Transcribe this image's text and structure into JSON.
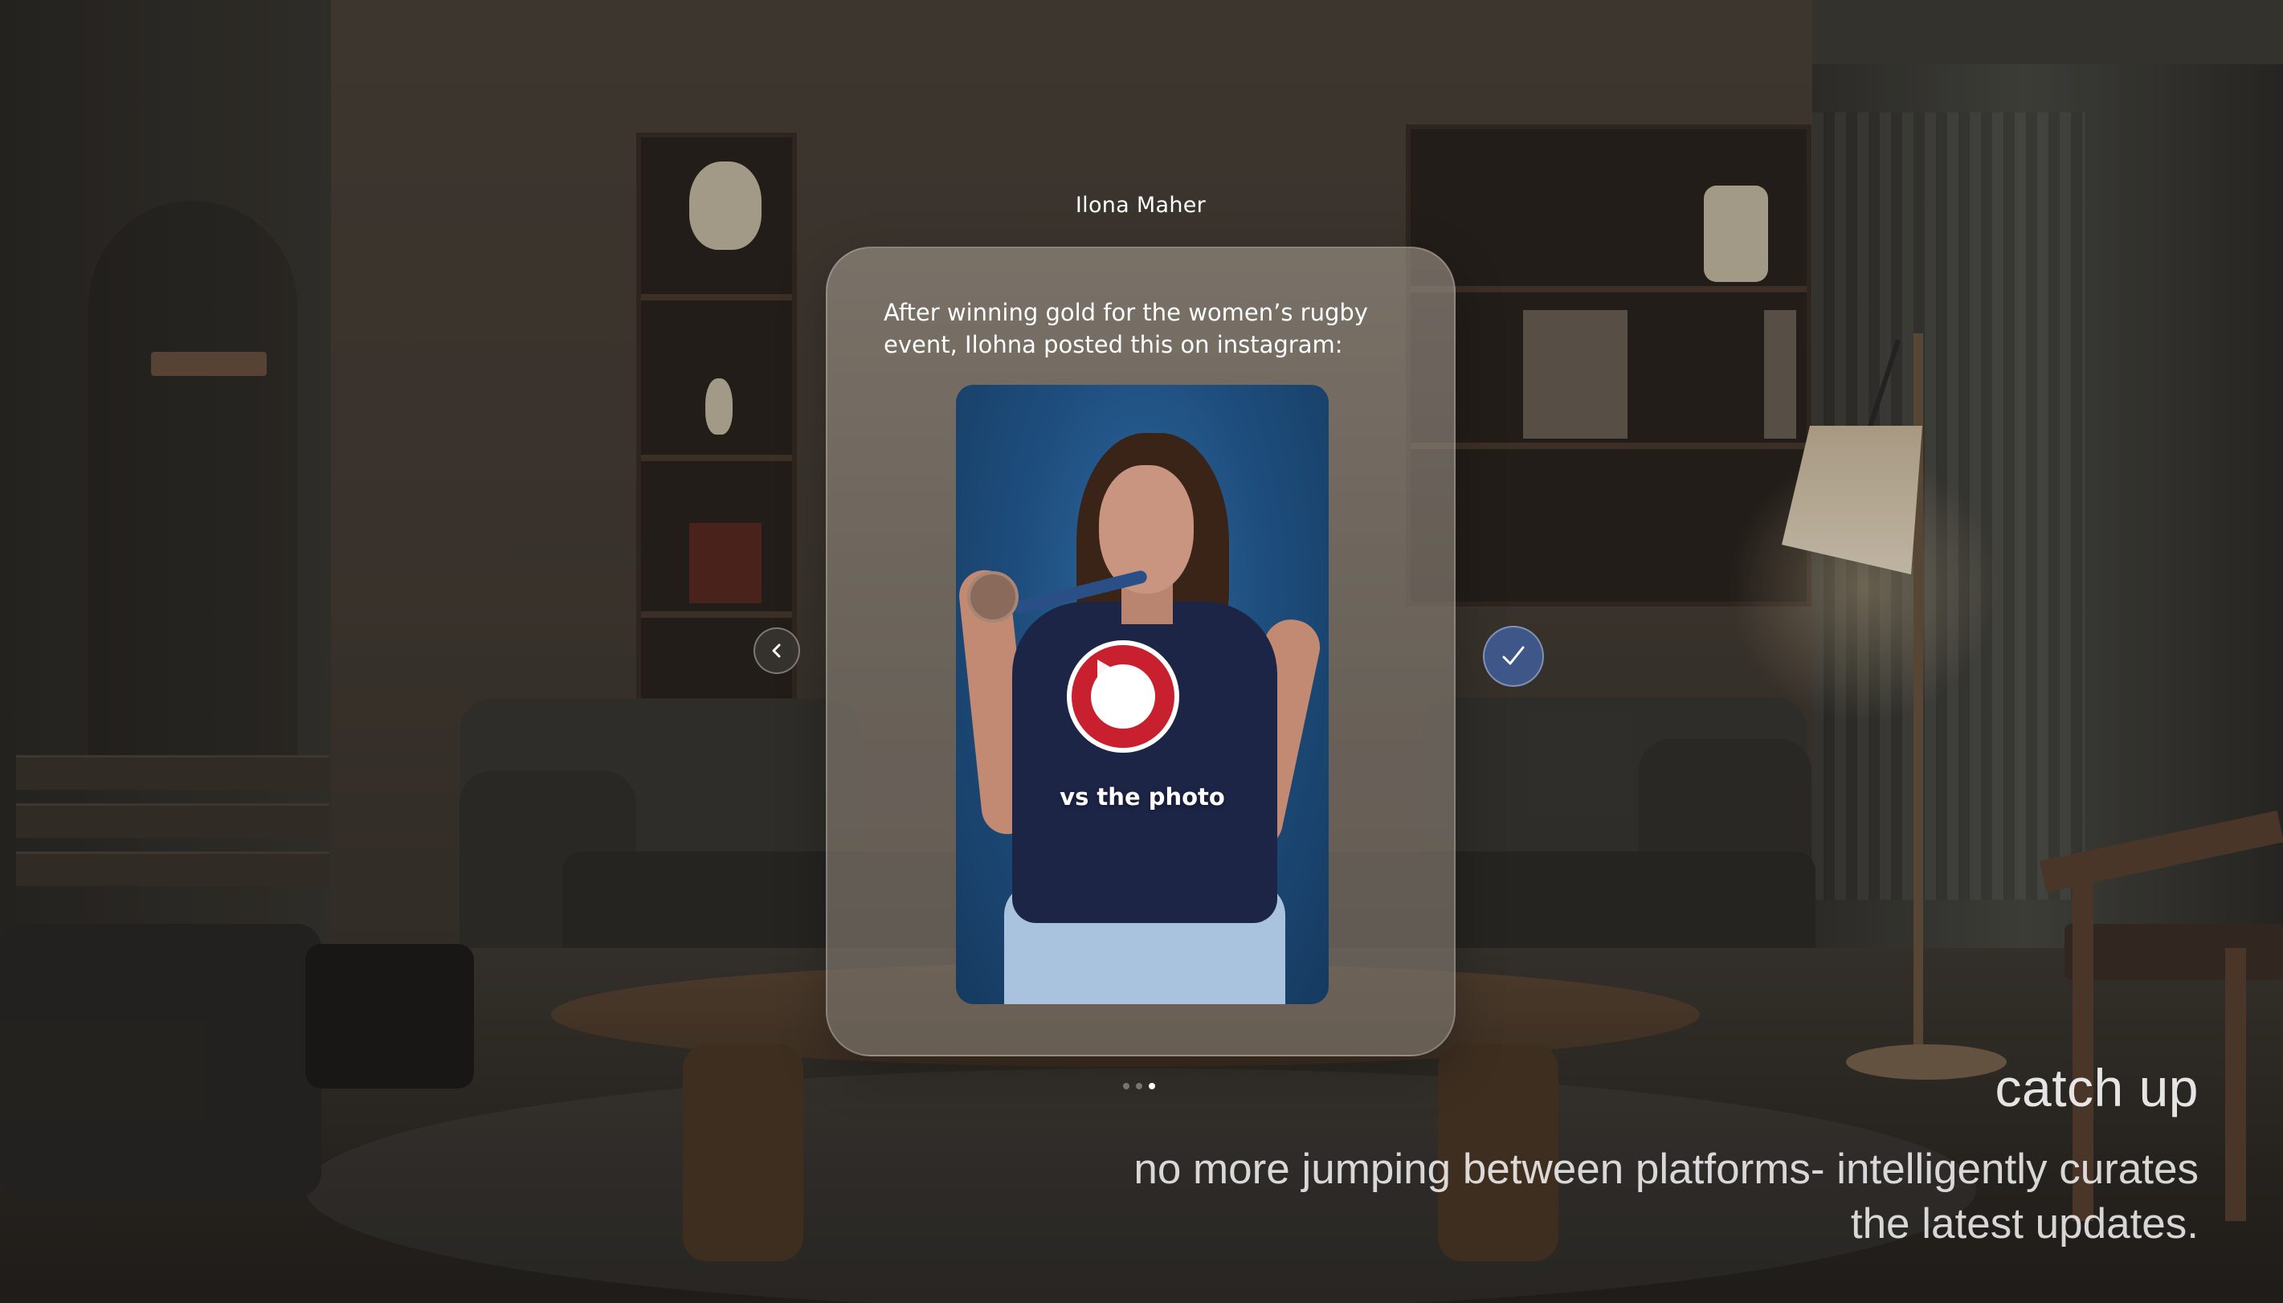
{
  "post": {
    "author": "Ilona Maher",
    "text": "After winning gold for the women’s rugby event, Ilohna posted this on instagram:",
    "media_caption": "vs the photo",
    "media_type": "video"
  },
  "controls": {
    "prev_icon": "chevron-left-icon",
    "confirm_icon": "checkmark-icon",
    "accent_color": "#3f5688"
  },
  "pagination": {
    "total": 3,
    "active_index": 2
  },
  "marketing": {
    "title": "catch up",
    "subtitle": "no more jumping between platforms- intelligently curates the latest updates."
  }
}
